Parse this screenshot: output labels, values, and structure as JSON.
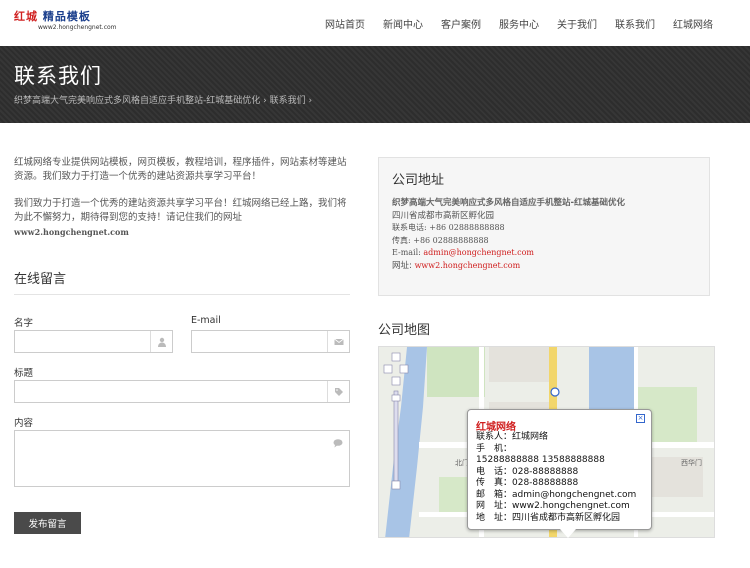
{
  "logo": {
    "brand_a": "红城",
    "brand_b": "精品模板",
    "url": "www2.hongchengnet.com"
  },
  "nav": [
    "网站首页",
    "新闻中心",
    "客户案例",
    "服务中心",
    "关于我们",
    "联系我们",
    "红城网络"
  ],
  "banner": {
    "title": "联系我们",
    "crumb_1": "织梦高端大气完美响应式多风格自适应手机整站-红城基础优化",
    "sep_1": "›",
    "crumb_2": "联系我们",
    "sep_2": "›"
  },
  "intro": {
    "p1": "红城网络专业提供网站模板，网页模板，教程培训，程序插件，网站素材等建站资源。我们致力于打造一个优秀的建站资源共享学习平台！",
    "p2": "我们致力于打造一个优秀的建站资源共享学习平台！红城网络已经上路，我们将为此不懈努力，期待得到您的支持！请记住我们的网址",
    "url": "www2.hongchengnet.com"
  },
  "form": {
    "title": "在线留言",
    "name_label": "名字",
    "email_label": "E-mail",
    "subject_label": "标题",
    "content_label": "内容",
    "submit_label": "发布留言"
  },
  "address": {
    "title": "公司地址",
    "company": "织梦高端大气完美响应式多风格自适应手机整站-红城基础优化",
    "location": "四川省成都市高新区孵化园",
    "phone": "联系电话: +86 02888888888",
    "fax": "传真: +86 02888888888",
    "email_prefix": "E-mail: ",
    "email": "admin@hongchengnet.com",
    "site_prefix": "网址: ",
    "site": "www2.hongchengnet.com"
  },
  "map": {
    "title": "公司地图",
    "label_a": "西华门",
    "label_b": "北门",
    "popup": {
      "title": "红城网络",
      "close": "×",
      "contact": "联系人：红城网络",
      "mobile_label": "手　机：",
      "mobile": "15288888888 13588888888",
      "tel": "电　话：028-88888888",
      "fax": "传　真：028-88888888",
      "email": "邮　箱：admin@hongchengnet.com",
      "site": "网　址：www2.hongchengnet.com",
      "address": "地　址：四川省成都市高新区孵化园"
    }
  },
  "colors": {
    "banner_bg": "#2f2f2f",
    "accent_red": "#d02020",
    "button_bg": "#4a4a4a"
  }
}
